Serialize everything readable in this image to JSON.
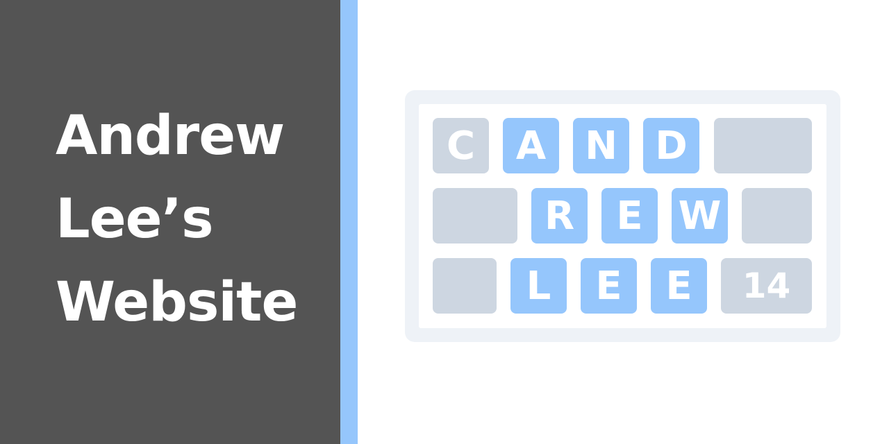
{
  "title": {
    "line1": "Andrew",
    "line2": "Lee’s",
    "line3": "Website"
  },
  "board": {
    "row1": [
      "C",
      "A",
      "N",
      "D",
      ""
    ],
    "row2": [
      "",
      "R",
      "E",
      "W",
      ""
    ],
    "row3": [
      "",
      "L",
      "E",
      "E",
      "14"
    ]
  },
  "colors": {
    "panel": "#545454",
    "accent": "#95c6fc",
    "tile_gray": "#cdd6e1",
    "tile_blue": "#95c6fc",
    "frame": "#eef2f7"
  }
}
